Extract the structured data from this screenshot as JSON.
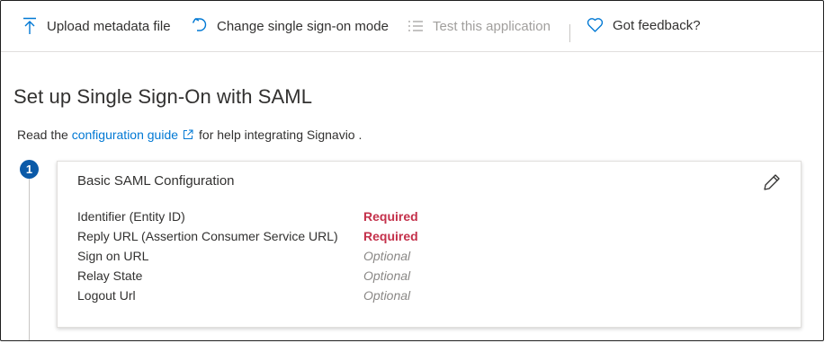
{
  "toolbar": {
    "upload_label": "Upload metadata file",
    "change_mode_label": "Change single sign-on mode",
    "test_label": "Test this application",
    "feedback_label": "Got feedback?"
  },
  "page": {
    "title": "Set up Single Sign-On with SAML",
    "intro_prefix": "Read the",
    "intro_link": "configuration guide",
    "intro_suffix": "for help integrating Signavio ."
  },
  "step": {
    "number": "1",
    "card_title": "Basic SAML Configuration",
    "rows": [
      {
        "label": "Identifier (Entity ID)",
        "value": "Required",
        "status": "required"
      },
      {
        "label": "Reply URL (Assertion Consumer Service URL)",
        "value": "Required",
        "status": "required"
      },
      {
        "label": "Sign on URL",
        "value": "Optional",
        "status": "optional"
      },
      {
        "label": "Relay State",
        "value": "Optional",
        "status": "optional"
      },
      {
        "label": "Logout Url",
        "value": "Optional",
        "status": "optional"
      }
    ]
  },
  "colors": {
    "accent": "#0078d4",
    "required": "#c4314b",
    "optional": "#8a8886",
    "step_badge": "#0b5aa8"
  },
  "icons": [
    "upload-icon",
    "undo-icon",
    "test-list-icon",
    "heart-icon",
    "external-link-icon",
    "pencil-icon"
  ]
}
